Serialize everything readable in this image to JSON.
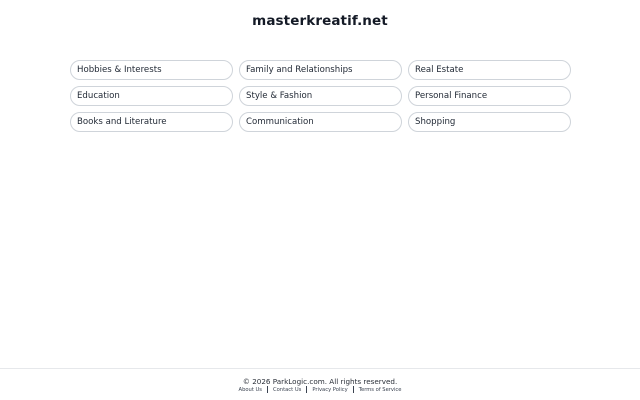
{
  "site": {
    "title": "masterkreatif.net"
  },
  "categories": [
    {
      "label": "Hobbies & Interests"
    },
    {
      "label": "Family and Relationships"
    },
    {
      "label": "Real Estate"
    },
    {
      "label": "Education"
    },
    {
      "label": "Style & Fashion"
    },
    {
      "label": "Personal Finance"
    },
    {
      "label": "Books and Literature"
    },
    {
      "label": "Communication"
    },
    {
      "label": "Shopping"
    }
  ],
  "footer": {
    "copyright": "© 2026 ParkLogic.com. All rights reserved.",
    "links": [
      {
        "label": "About Us"
      },
      {
        "label": "Contact Us"
      },
      {
        "label": "Privacy Policy"
      },
      {
        "label": "Terms of Service"
      }
    ]
  }
}
